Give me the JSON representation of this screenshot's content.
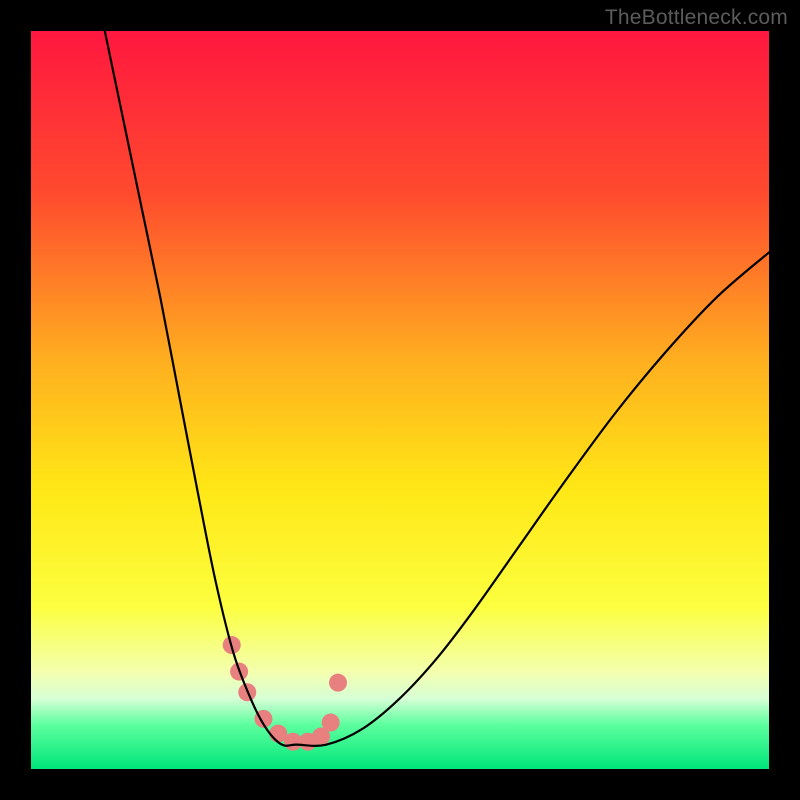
{
  "attribution": "TheBottleneck.com",
  "chart_data": {
    "type": "line",
    "title": "",
    "xlabel": "",
    "ylabel": "",
    "xlim": [
      0,
      100
    ],
    "ylim": [
      0,
      100
    ],
    "grid": false,
    "legend": false,
    "gradient_stops": [
      {
        "offset": 0.0,
        "color": "#ff173f"
      },
      {
        "offset": 0.22,
        "color": "#ff4a2e"
      },
      {
        "offset": 0.45,
        "color": "#ffb01f"
      },
      {
        "offset": 0.62,
        "color": "#ffe716"
      },
      {
        "offset": 0.78,
        "color": "#fcff3f"
      },
      {
        "offset": 0.87,
        "color": "#f3ffb0"
      },
      {
        "offset": 0.905,
        "color": "#d6ffd6"
      },
      {
        "offset": 0.94,
        "color": "#5dff9e"
      },
      {
        "offset": 1.0,
        "color": "#00e57a"
      }
    ],
    "series": [
      {
        "name": "bottleneck-curve",
        "x": [
          10.0,
          12.5,
          15.0,
          17.5,
          20.0,
          22.5,
          25.0,
          27.5,
          30.0,
          32.0,
          34.0,
          36.0,
          40.0,
          45.0,
          50.0,
          55.0,
          60.0,
          66.0,
          72.0,
          79.0,
          86.0,
          93.0,
          100.0
        ],
        "y": [
          100.0,
          88.0,
          76.0,
          64.0,
          51.0,
          38.0,
          25.5,
          15.5,
          9.0,
          5.3,
          3.3,
          3.3,
          3.3,
          5.5,
          9.6,
          15.0,
          21.5,
          30.0,
          38.5,
          48.0,
          56.5,
          64.0,
          70.0
        ]
      }
    ],
    "markers": {
      "name": "highlight-dots",
      "color": "#e98080",
      "radius": 9,
      "x": [
        27.2,
        28.2,
        29.3,
        31.5,
        33.5,
        35.5,
        37.5,
        39.3,
        40.6,
        41.6
      ],
      "y": [
        16.8,
        13.2,
        10.4,
        6.8,
        4.8,
        3.7,
        3.7,
        4.4,
        6.3,
        11.7
      ]
    }
  }
}
